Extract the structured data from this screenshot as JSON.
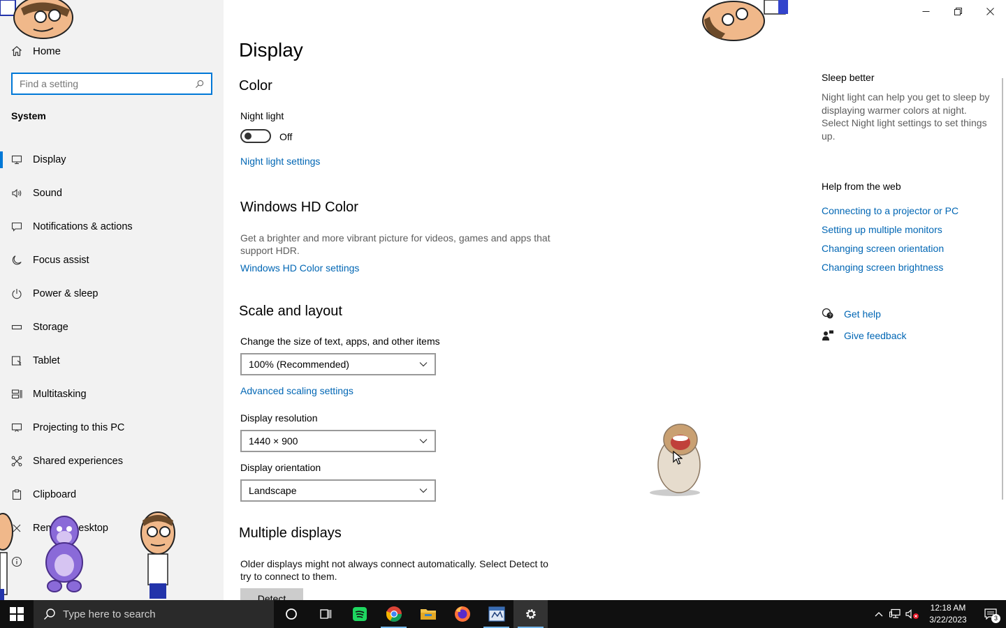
{
  "sidebar": {
    "home_label": "Home",
    "search_placeholder": "Find a setting",
    "section": "System",
    "items": [
      {
        "label": "Display",
        "icon": "monitor-icon",
        "active": true
      },
      {
        "label": "Sound",
        "icon": "speaker-icon"
      },
      {
        "label": "Notifications & actions",
        "icon": "message-icon"
      },
      {
        "label": "Focus assist",
        "icon": "moon-icon"
      },
      {
        "label": "Power & sleep",
        "icon": "power-icon"
      },
      {
        "label": "Storage",
        "icon": "storage-icon"
      },
      {
        "label": "Tablet",
        "icon": "tablet-icon"
      },
      {
        "label": "Multitasking",
        "icon": "multitasking-icon"
      },
      {
        "label": "Projecting to this PC",
        "icon": "projecting-icon"
      },
      {
        "label": "Shared experiences",
        "icon": "shared-icon"
      },
      {
        "label": "Clipboard",
        "icon": "clipboard-icon"
      },
      {
        "label": "Remote Desktop",
        "icon": "remote-desktop-icon"
      },
      {
        "label": "",
        "icon": "about-icon"
      }
    ]
  },
  "main": {
    "title": "Display",
    "color": {
      "heading": "Color",
      "night_light_label": "Night light",
      "night_light_state": "Off",
      "night_light_settings_link": "Night light settings"
    },
    "hd_color": {
      "heading": "Windows HD Color",
      "description": "Get a brighter and more vibrant picture for videos, games and apps that support HDR.",
      "settings_link": "Windows HD Color settings"
    },
    "scale_layout": {
      "heading": "Scale and layout",
      "size_label": "Change the size of text, apps, and other items",
      "size_value": "100% (Recommended)",
      "advanced_link": "Advanced scaling settings",
      "resolution_label": "Display resolution",
      "resolution_value": "1440 × 900",
      "orientation_label": "Display orientation",
      "orientation_value": "Landscape"
    },
    "multiple_displays": {
      "heading": "Multiple displays",
      "description": "Older displays might not always connect automatically. Select Detect to try to connect to them.",
      "detect_button": "Detect"
    }
  },
  "right": {
    "sleep_heading": "Sleep better",
    "sleep_text": "Night light can help you get to sleep by displaying warmer colors at night. Select Night light settings to set things up.",
    "help_heading": "Help from the web",
    "help_links": [
      "Connecting to a projector or PC",
      "Setting up multiple monitors",
      "Changing screen orientation",
      "Changing screen brightness"
    ],
    "get_help": "Get help",
    "give_feedback": "Give feedback"
  },
  "taskbar": {
    "search_placeholder": "Type here to search",
    "time": "12:18 AM",
    "date": "3/22/2023",
    "notification_count": "3"
  },
  "colors": {
    "accent": "#0078d7",
    "link": "#0066b4",
    "sidebar_bg": "#f2f2f2",
    "taskbar_bg": "#101010"
  }
}
